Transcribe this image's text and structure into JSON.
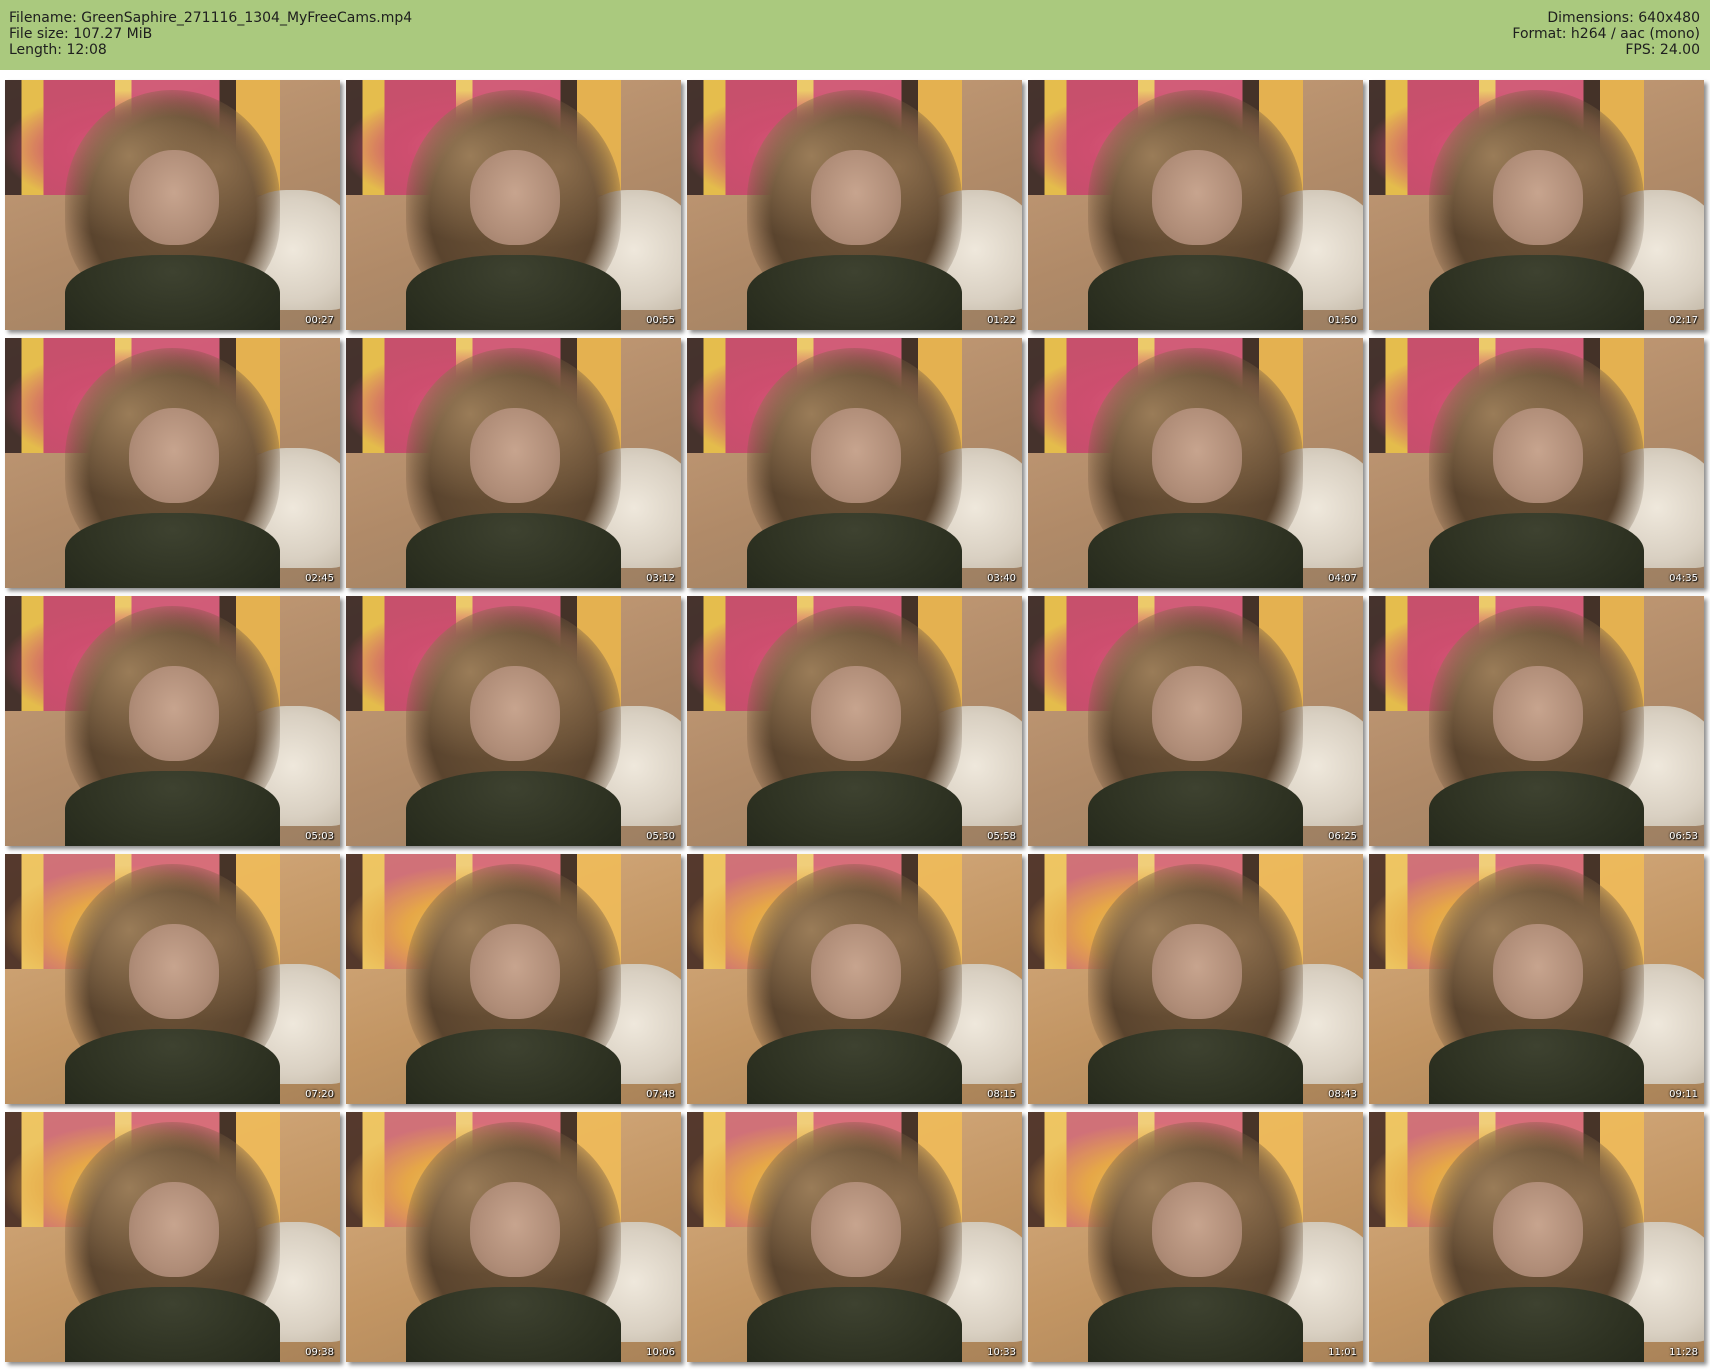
{
  "header": {
    "filename_line": "Filename: GreenSaphire_271116_1304_MyFreeCams.mp4",
    "filesize_line": "File size: 107.27 MiB",
    "length_line": "Length: 12:08",
    "dimensions_line": "Dimensions: 640x480",
    "format_line": "Format: h264 / aac (mono)",
    "fps_line": "FPS: 24.00",
    "background_color": "#aac97e"
  },
  "thumbnails": [
    {
      "time": "00:27"
    },
    {
      "time": "00:55"
    },
    {
      "time": "01:22"
    },
    {
      "time": "01:50"
    },
    {
      "time": "02:17"
    },
    {
      "time": "02:45"
    },
    {
      "time": "03:12"
    },
    {
      "time": "03:40"
    },
    {
      "time": "04:07"
    },
    {
      "time": "04:35"
    },
    {
      "time": "05:03"
    },
    {
      "time": "05:30"
    },
    {
      "time": "05:58"
    },
    {
      "time": "06:25"
    },
    {
      "time": "06:53"
    },
    {
      "time": "07:20"
    },
    {
      "time": "07:48"
    },
    {
      "time": "08:15"
    },
    {
      "time": "08:43"
    },
    {
      "time": "09:11"
    },
    {
      "time": "09:38"
    },
    {
      "time": "10:06"
    },
    {
      "time": "10:33"
    },
    {
      "time": "11:01"
    },
    {
      "time": "11:28"
    }
  ]
}
